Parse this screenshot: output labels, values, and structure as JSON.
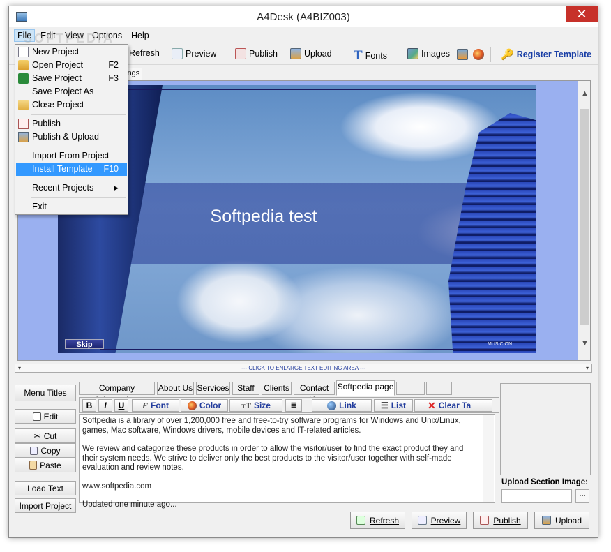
{
  "window": {
    "title": "A4Desk (A4BIZ003)",
    "close_glyph": "✕"
  },
  "menubar": {
    "items": [
      "File",
      "Edit",
      "View",
      "Options",
      "Help"
    ]
  },
  "file_menu": {
    "items": [
      {
        "label": "New Project",
        "shortcut": "",
        "icon": "new-document-icon"
      },
      {
        "label": "Open Project",
        "shortcut": "F2",
        "icon": "open-folder-icon"
      },
      {
        "label": "Save Project",
        "shortcut": "F3",
        "icon": "save-disk-icon"
      },
      {
        "label": "Save Project As",
        "shortcut": "",
        "icon": ""
      },
      {
        "label": "Close Project",
        "shortcut": "",
        "icon": "close-folder-icon"
      },
      {
        "label": "Publish",
        "shortcut": "",
        "icon": "publish-icon"
      },
      {
        "label": "Publish & Upload",
        "shortcut": "",
        "icon": "publish-upload-icon"
      },
      {
        "label": "Import From Project",
        "shortcut": "",
        "icon": ""
      },
      {
        "label": "Install Template",
        "shortcut": "F10",
        "icon": ""
      },
      {
        "label": "Recent Projects",
        "shortcut": "▸",
        "icon": ""
      },
      {
        "label": "Exit",
        "shortcut": "",
        "icon": ""
      }
    ],
    "highlighted": "Install Template"
  },
  "toolbar": {
    "refresh": "Refresh",
    "preview": "Preview",
    "publish": "Publish",
    "upload": "Upload",
    "fonts": "Fonts",
    "images": "Images",
    "register": "Register Template"
  },
  "tabs_top": {
    "settings_partial": "ttings"
  },
  "preview": {
    "banner_title": "Softpedia test",
    "skip": "Skip",
    "music": "MUSIC ON"
  },
  "enlarge_bar": {
    "label": "--- CLICK TO ENLARGE TEXT EDITING AREA ---",
    "left_arrow": "▾",
    "right_arrow": "▾"
  },
  "left_buttons": {
    "menu_titles": "Menu Titles",
    "edit": "Edit",
    "cut": "Cut",
    "copy": "Copy",
    "paste": "Paste",
    "load_text": "Load Text",
    "import_project": "Import Project"
  },
  "page_tabs": [
    "Company Information",
    "About Us",
    "Services",
    "Staff",
    "Clients",
    "Contact Us",
    "Softpedia page",
    "",
    ""
  ],
  "active_tab": "Softpedia page",
  "format_bar": {
    "bold": "B",
    "italic": "I",
    "underline": "U",
    "font": "Font",
    "color": "Color",
    "size": "Size",
    "link": "Link",
    "list": "List",
    "clear": "Clear Ta"
  },
  "content": {
    "p1": "Softpedia is a library of over 1,200,000 free and free-to-try software programs for Windows and Unix/Linux, games, Mac software, Windows drivers, mobile devices and IT-related articles.",
    "p2": "We review and categorize these products in order to allow the visitor/user to find the exact product they and their system needs. We strive to deliver only the best products to the visitor/user together with self-made evaluation and review notes.",
    "p3": "www.softpedia.com",
    "p4": "Updated one minute ago..."
  },
  "upload_section": {
    "label": "Upload Section Image:",
    "browse": "..."
  },
  "bottom_buttons": {
    "refresh": "Refresh",
    "preview": "Preview",
    "publish": "Publish",
    "upload": "Upload"
  },
  "watermark": "SOFTPEDIA"
}
